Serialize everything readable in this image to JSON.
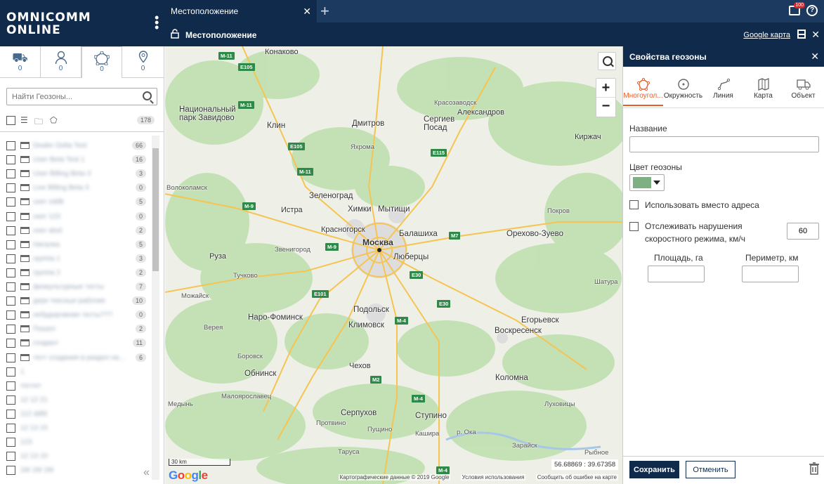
{
  "brand": {
    "line1": "OMNICOMM",
    "line2": "ONLINE"
  },
  "tabs": [
    {
      "label": "Местоположение"
    }
  ],
  "notifications": {
    "count": "100"
  },
  "subheader": {
    "title": "Местоположение",
    "map_provider": "Google карта"
  },
  "sidebar": {
    "tabs": [
      {
        "icon": "truck-icon",
        "count": "0"
      },
      {
        "icon": "user-icon",
        "count": "0"
      },
      {
        "icon": "geozone-icon",
        "count": "0"
      },
      {
        "icon": "location-pin-icon",
        "count": "0"
      }
    ],
    "search_placeholder": "Найти Геозоны...",
    "total_count": "178",
    "items": [
      {
        "name": "Dealer Delta Test",
        "count": "66",
        "folder": true
      },
      {
        "name": "User Beta Test 1",
        "count": "16",
        "folder": true
      },
      {
        "name": "User Billing Beta 3",
        "count": "3",
        "folder": true
      },
      {
        "name": "Live Billing Beta 3",
        "count": "0",
        "folder": true
      },
      {
        "name": "user zddb",
        "count": "5",
        "folder": true
      },
      {
        "name": "user 123",
        "count": "0",
        "folder": true
      },
      {
        "name": "user alod",
        "count": "2",
        "folder": true
      },
      {
        "name": "Нигалка",
        "count": "5",
        "folder": true
      },
      {
        "name": "группа 1",
        "count": "3",
        "folder": true
      },
      {
        "name": "группа 2",
        "count": "2",
        "folder": true
      },
      {
        "name": "физкультурные тесты",
        "count": "7",
        "folder": true
      },
      {
        "name": "дерк тексные рабочие",
        "count": "10",
        "folder": true
      },
      {
        "name": "небудорожние тесты???",
        "count": "0",
        "folder": true
      },
      {
        "name": "Пошел",
        "count": "2",
        "folder": true
      },
      {
        "name": "создант",
        "count": "11",
        "folder": true
      },
      {
        "name": "тест создания в раздел на...",
        "count": "6",
        "folder": true
      },
      {
        "name": "1",
        "count": "",
        "folder": false
      },
      {
        "name": "тестит",
        "count": "",
        "folder": false
      },
      {
        "name": "12 12 21",
        "count": "",
        "folder": false
      },
      {
        "name": "112 ddfd",
        "count": "",
        "folder": false
      },
      {
        "name": "12 13 15",
        "count": "",
        "folder": false
      },
      {
        "name": "123",
        "count": "",
        "folder": false
      },
      {
        "name": "12 13 10",
        "count": "",
        "folder": false
      },
      {
        "name": "1M 1M 1M",
        "count": "",
        "folder": false
      }
    ]
  },
  "map": {
    "labels": [
      {
        "text": "Конаково",
        "cls": ""
      },
      {
        "text": "Красозаводск",
        "cls": "sm"
      },
      {
        "text": "Александров",
        "cls": ""
      },
      {
        "text": "Национальный\nпарк Завидово",
        "cls": "med"
      },
      {
        "text": "Клин",
        "cls": "med"
      },
      {
        "text": "Дмитров",
        "cls": "med"
      },
      {
        "text": "Сергиев\nПосад",
        "cls": "med"
      },
      {
        "text": "Яхрома",
        "cls": "sm"
      },
      {
        "text": "Киржач",
        "cls": ""
      },
      {
        "text": "Волоколамск",
        "cls": "sm"
      },
      {
        "text": "Зеленоград",
        "cls": "med"
      },
      {
        "text": "Истра",
        "cls": ""
      },
      {
        "text": "Химки",
        "cls": "med"
      },
      {
        "text": "Мытищи",
        "cls": "med"
      },
      {
        "text": "Покров",
        "cls": "sm"
      },
      {
        "text": "Красногорск",
        "cls": ""
      },
      {
        "text": "Балашиха",
        "cls": "med"
      },
      {
        "text": "Орехово-Зуево",
        "cls": "med"
      },
      {
        "text": "Москва",
        "cls": "big"
      },
      {
        "text": "Звенигород",
        "cls": "sm"
      },
      {
        "text": "Люберцы",
        "cls": "med"
      },
      {
        "text": "Руза",
        "cls": ""
      },
      {
        "text": "Тучково",
        "cls": "sm"
      },
      {
        "text": "Шатура",
        "cls": "sm"
      },
      {
        "text": "Можайск",
        "cls": "sm"
      },
      {
        "text": "Подольск",
        "cls": "med"
      },
      {
        "text": "Наро-Фоминск",
        "cls": "med"
      },
      {
        "text": "Егорьевск",
        "cls": "med"
      },
      {
        "text": "Верея",
        "cls": "sm"
      },
      {
        "text": "Климовск",
        "cls": "med"
      },
      {
        "text": "Воскресенск",
        "cls": "med"
      },
      {
        "text": "Боровск",
        "cls": "sm"
      },
      {
        "text": "Чехов",
        "cls": ""
      },
      {
        "text": "Обнинск",
        "cls": "med"
      },
      {
        "text": "Коломна",
        "cls": "med"
      },
      {
        "text": "Малоярославец",
        "cls": "sm"
      },
      {
        "text": "Медынь",
        "cls": "sm"
      },
      {
        "text": "Луховицы",
        "cls": "sm"
      },
      {
        "text": "Серпухов",
        "cls": "med"
      },
      {
        "text": "Ступино",
        "cls": "med"
      },
      {
        "text": "Протвино",
        "cls": "sm"
      },
      {
        "text": "Пущино",
        "cls": "sm"
      },
      {
        "text": "Кашира",
        "cls": "sm"
      },
      {
        "text": "р. Ока",
        "cls": "sm"
      },
      {
        "text": "Зарайск",
        "cls": "sm"
      },
      {
        "text": "Таруса",
        "cls": "sm"
      },
      {
        "text": "Рыбное",
        "cls": "sm"
      }
    ],
    "highways": [
      "M-11",
      "E105",
      "M-11",
      "E105",
      "M-11",
      "E115",
      "M-9",
      "M-9",
      "M7",
      "E30",
      "E101",
      "E30",
      "M-4",
      "M2",
      "M-4",
      "M-4"
    ],
    "scale": "30 km",
    "coords": "56.68869 : 39.67358",
    "footer": [
      "Картографические данные © 2019 Google",
      "Условия использования",
      "Сообщить об ошибке на карте"
    ]
  },
  "panel": {
    "title": "Свойства геозоны",
    "tabs": [
      "Многоугол...",
      "Окружность",
      "Линия",
      "Карта",
      "Объект"
    ],
    "name_label": "Название",
    "name_value": "",
    "color_label": "Цвет геозоны",
    "color_value": "#7fb083",
    "use_address_label": "Использовать вместо адреса",
    "speed_label_1": "Отслеживать нарушения",
    "speed_label_2": "скоростного режима, км/ч",
    "speed_value": "60",
    "area_label": "Площадь, га",
    "perimeter_label": "Периметр, км",
    "save_label": "Сохранить",
    "cancel_label": "Отменить"
  }
}
